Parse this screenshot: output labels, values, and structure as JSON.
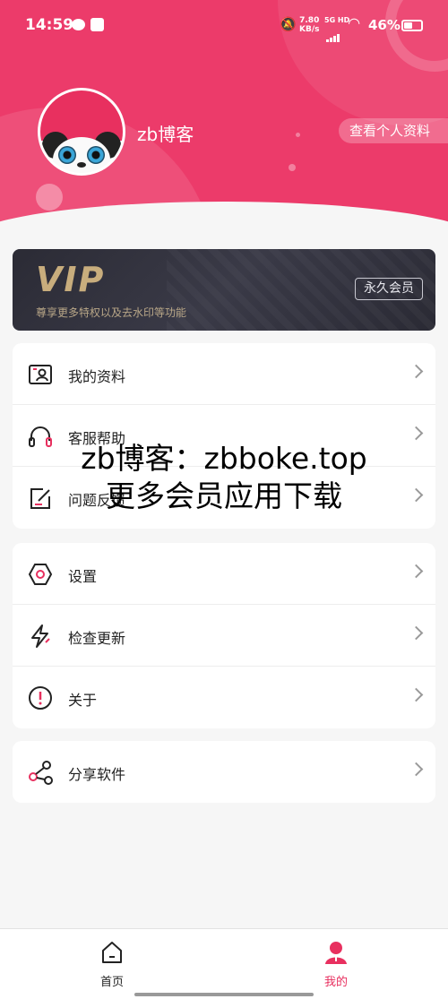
{
  "status_bar": {
    "time": "14:59",
    "net_speed_value": "7.80",
    "net_speed_unit": "KB/s",
    "network": "5G HD",
    "battery": "46%"
  },
  "profile": {
    "username": "zb博客",
    "view_profile_label": "查看个人资料"
  },
  "vip": {
    "logo": "VIP",
    "description": "尊享更多特权以及去水印等功能",
    "badge": "永久会员"
  },
  "menu_group_1": [
    {
      "label": "我的资料",
      "icon": "profile-card-icon"
    },
    {
      "label": "客服帮助",
      "icon": "headset-icon"
    },
    {
      "label": "问题反馈",
      "icon": "edit-feedback-icon"
    }
  ],
  "menu_group_2": [
    {
      "label": "设置",
      "icon": "settings-hex-icon"
    },
    {
      "label": "检查更新",
      "icon": "lightning-icon"
    },
    {
      "label": "关于",
      "icon": "info-circle-icon"
    }
  ],
  "menu_group_3": [
    {
      "label": "分享软件",
      "icon": "share-icon"
    }
  ],
  "watermark": {
    "line1": "zb博客：zbboke.top",
    "line2": "更多会员应用下载"
  },
  "bottom_nav": {
    "home_label": "首页",
    "mine_label": "我的"
  },
  "colors": {
    "accent": "#e8305f",
    "header": "#ec3b6a",
    "vip_gold": "#c8ad7d"
  }
}
